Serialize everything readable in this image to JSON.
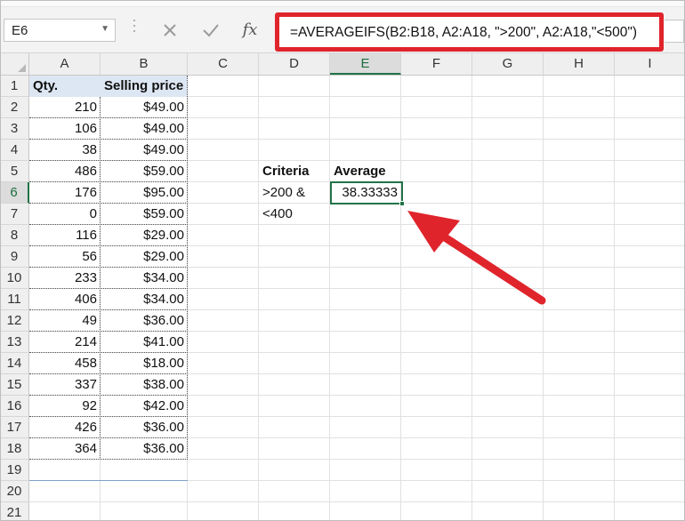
{
  "name_box": {
    "value": "E6",
    "dropdown_icon": "chevron-down-icon"
  },
  "formula_bar": {
    "cancel_icon": "close-icon",
    "enter_icon": "check-icon",
    "fx_label": "fx",
    "formula": "=AVERAGEIFS(B2:B18, A2:A18, \">200\", A2:A18,\"<500\")",
    "highlight_color": "#e0242b"
  },
  "columns": [
    "A",
    "B",
    "C",
    "D",
    "E",
    "F",
    "G",
    "H",
    "I"
  ],
  "selected_column": "E",
  "rows": [
    "1",
    "2",
    "3",
    "4",
    "5",
    "6",
    "7",
    "8",
    "9",
    "10",
    "11",
    "12",
    "13",
    "14",
    "15",
    "16",
    "17",
    "18",
    "19",
    "20",
    "21"
  ],
  "selected_row": "6",
  "table": {
    "headers": {
      "qty": "Qty.",
      "price": "Selling price"
    },
    "header_fill": "#dde6f3",
    "data": [
      {
        "qty": "210",
        "price": "$49.00"
      },
      {
        "qty": "106",
        "price": "$49.00"
      },
      {
        "qty": "38",
        "price": "$49.00"
      },
      {
        "qty": "486",
        "price": "$59.00"
      },
      {
        "qty": "176",
        "price": "$95.00"
      },
      {
        "qty": "0",
        "price": "$59.00"
      },
      {
        "qty": "116",
        "price": "$29.00"
      },
      {
        "qty": "56",
        "price": "$29.00"
      },
      {
        "qty": "233",
        "price": "$34.00"
      },
      {
        "qty": "406",
        "price": "$34.00"
      },
      {
        "qty": "49",
        "price": "$36.00"
      },
      {
        "qty": "214",
        "price": "$41.00"
      },
      {
        "qty": "458",
        "price": "$18.00"
      },
      {
        "qty": "337",
        "price": "$38.00"
      },
      {
        "qty": "92",
        "price": "$42.00"
      },
      {
        "qty": "426",
        "price": "$36.00"
      },
      {
        "qty": "364",
        "price": "$36.00"
      }
    ]
  },
  "criteria": {
    "label": "Criteria",
    "line1": ">200 &",
    "line2": "<400"
  },
  "average": {
    "label": "Average",
    "value": "38.33333"
  },
  "active_cell": "E6",
  "accent_color": "#217346",
  "annotation_arrow_color": "#e0242b"
}
